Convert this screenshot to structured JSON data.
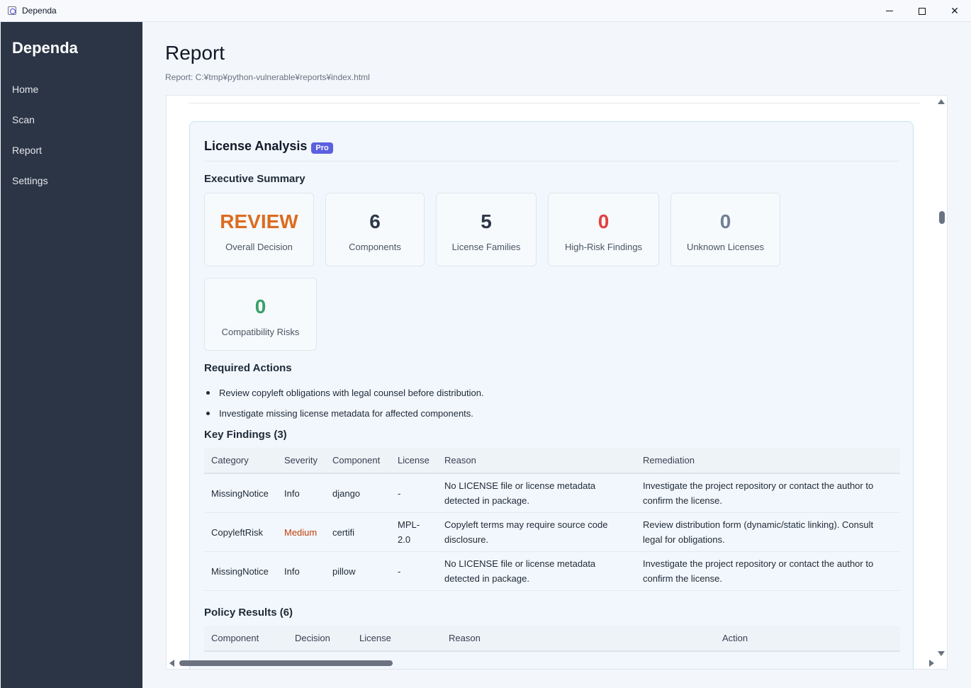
{
  "window": {
    "title": "Dependa"
  },
  "sidebar": {
    "brand": "Dependa",
    "items": [
      {
        "label": "Home"
      },
      {
        "label": "Scan"
      },
      {
        "label": "Report"
      },
      {
        "label": "Settings"
      }
    ]
  },
  "main": {
    "title": "Report",
    "report_path": "Report: C:¥tmp¥python-vulnerable¥reports¥index.html"
  },
  "license": {
    "title": "License Analysis",
    "badge": "Pro",
    "summary_title": "Executive Summary",
    "cards": [
      {
        "value": "REVIEW",
        "label": "Overall Decision",
        "color": "#dd6b20"
      },
      {
        "value": "6",
        "label": "Components",
        "color": "#2d3748"
      },
      {
        "value": "5",
        "label": "License Families",
        "color": "#2d3748"
      },
      {
        "value": "0",
        "label": "High-Risk Findings",
        "color": "#e53e3e"
      },
      {
        "value": "0",
        "label": "Unknown Licenses",
        "color": "#718096"
      },
      {
        "value": "0",
        "label": "Compatibility Risks",
        "color": "#38a169"
      }
    ],
    "actions_title": "Required Actions",
    "actions": [
      "Review copyleft obligations with legal counsel before distribution.",
      "Investigate missing license metadata for affected components."
    ],
    "findings_title": "Key Findings (3)",
    "findings_headers": [
      "Category",
      "Severity",
      "Component",
      "License",
      "Reason",
      "Remediation"
    ],
    "findings": [
      {
        "category": "MissingNotice",
        "severity": "Info",
        "component": "django",
        "license": "-",
        "reason": "No LICENSE file or license metadata detected in package.",
        "remediation": "Investigate the project repository or contact the author to confirm the license."
      },
      {
        "category": "CopyleftRisk",
        "severity": "Medium",
        "component": "certifi",
        "license": "MPL-2.0",
        "reason": "Copyleft terms may require source code disclosure.",
        "remediation": "Review distribution form (dynamic/static linking). Consult legal for obligations."
      },
      {
        "category": "MissingNotice",
        "severity": "Info",
        "component": "pillow",
        "license": "-",
        "reason": "No LICENSE file or license metadata detected in package.",
        "remediation": "Investigate the project repository or contact the author to confirm the license."
      }
    ],
    "policy_title": "Policy Results (6)",
    "policy_headers": [
      "Component",
      "Decision",
      "License",
      "Reason",
      "Action"
    ]
  }
}
